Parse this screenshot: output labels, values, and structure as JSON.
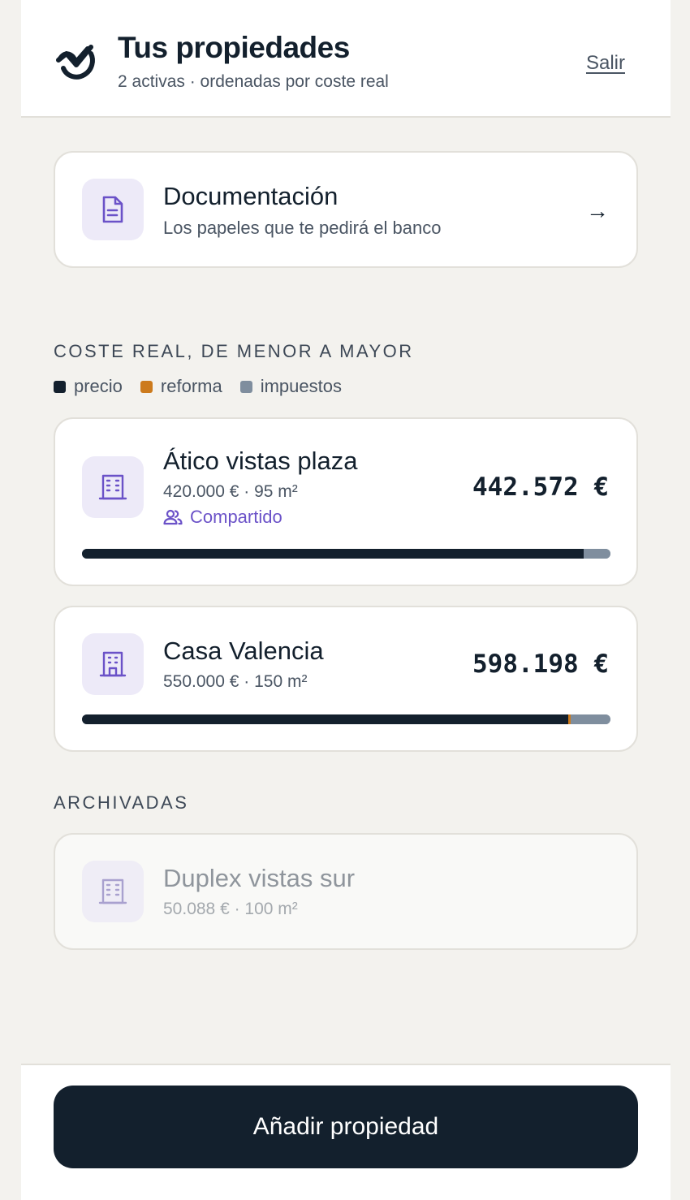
{
  "header": {
    "title": "Tus propiedades",
    "subtitle": "2 activas · ordenadas por coste real",
    "logout_label": "Salir"
  },
  "documentation": {
    "title": "Documentación",
    "subtitle": "Los papeles que te pedirá el banco",
    "arrow": "→",
    "icon": "document-icon"
  },
  "ranking": {
    "section_label": "COSTE REAL, DE MENOR A MAYOR",
    "legend": [
      {
        "label": "precio",
        "color": "#13202d"
      },
      {
        "label": "reforma",
        "color": "#cc7a1c"
      },
      {
        "label": "impuestos",
        "color": "#7f8e9e"
      }
    ]
  },
  "properties": [
    {
      "name": "Ático vistas plaza",
      "meta": "420.000 € · 95 m²",
      "shared_label": "Compartido",
      "total": "442.572 €",
      "icon": "building-icon",
      "cost_breakdown": {
        "precio": 420000,
        "reforma": 0,
        "impuestos": 22572
      }
    },
    {
      "name": "Casa Valencia",
      "meta": "550.000 € · 150 m²",
      "total": "598.198 €",
      "icon": "house-icon",
      "cost_breakdown": {
        "precio": 550000,
        "reforma": 3000,
        "impuestos": 45198
      }
    }
  ],
  "archived": {
    "section_label": "ARCHIVADAS",
    "items": [
      {
        "name": "Duplex vistas sur",
        "meta": "50.088 € · 100 m²",
        "icon": "building-icon"
      }
    ]
  },
  "footer": {
    "add_button_label": "Añadir propiedad"
  },
  "colors": {
    "accent": "#6b52c8",
    "dark": "#13202d",
    "background": "#f3f2ee"
  }
}
